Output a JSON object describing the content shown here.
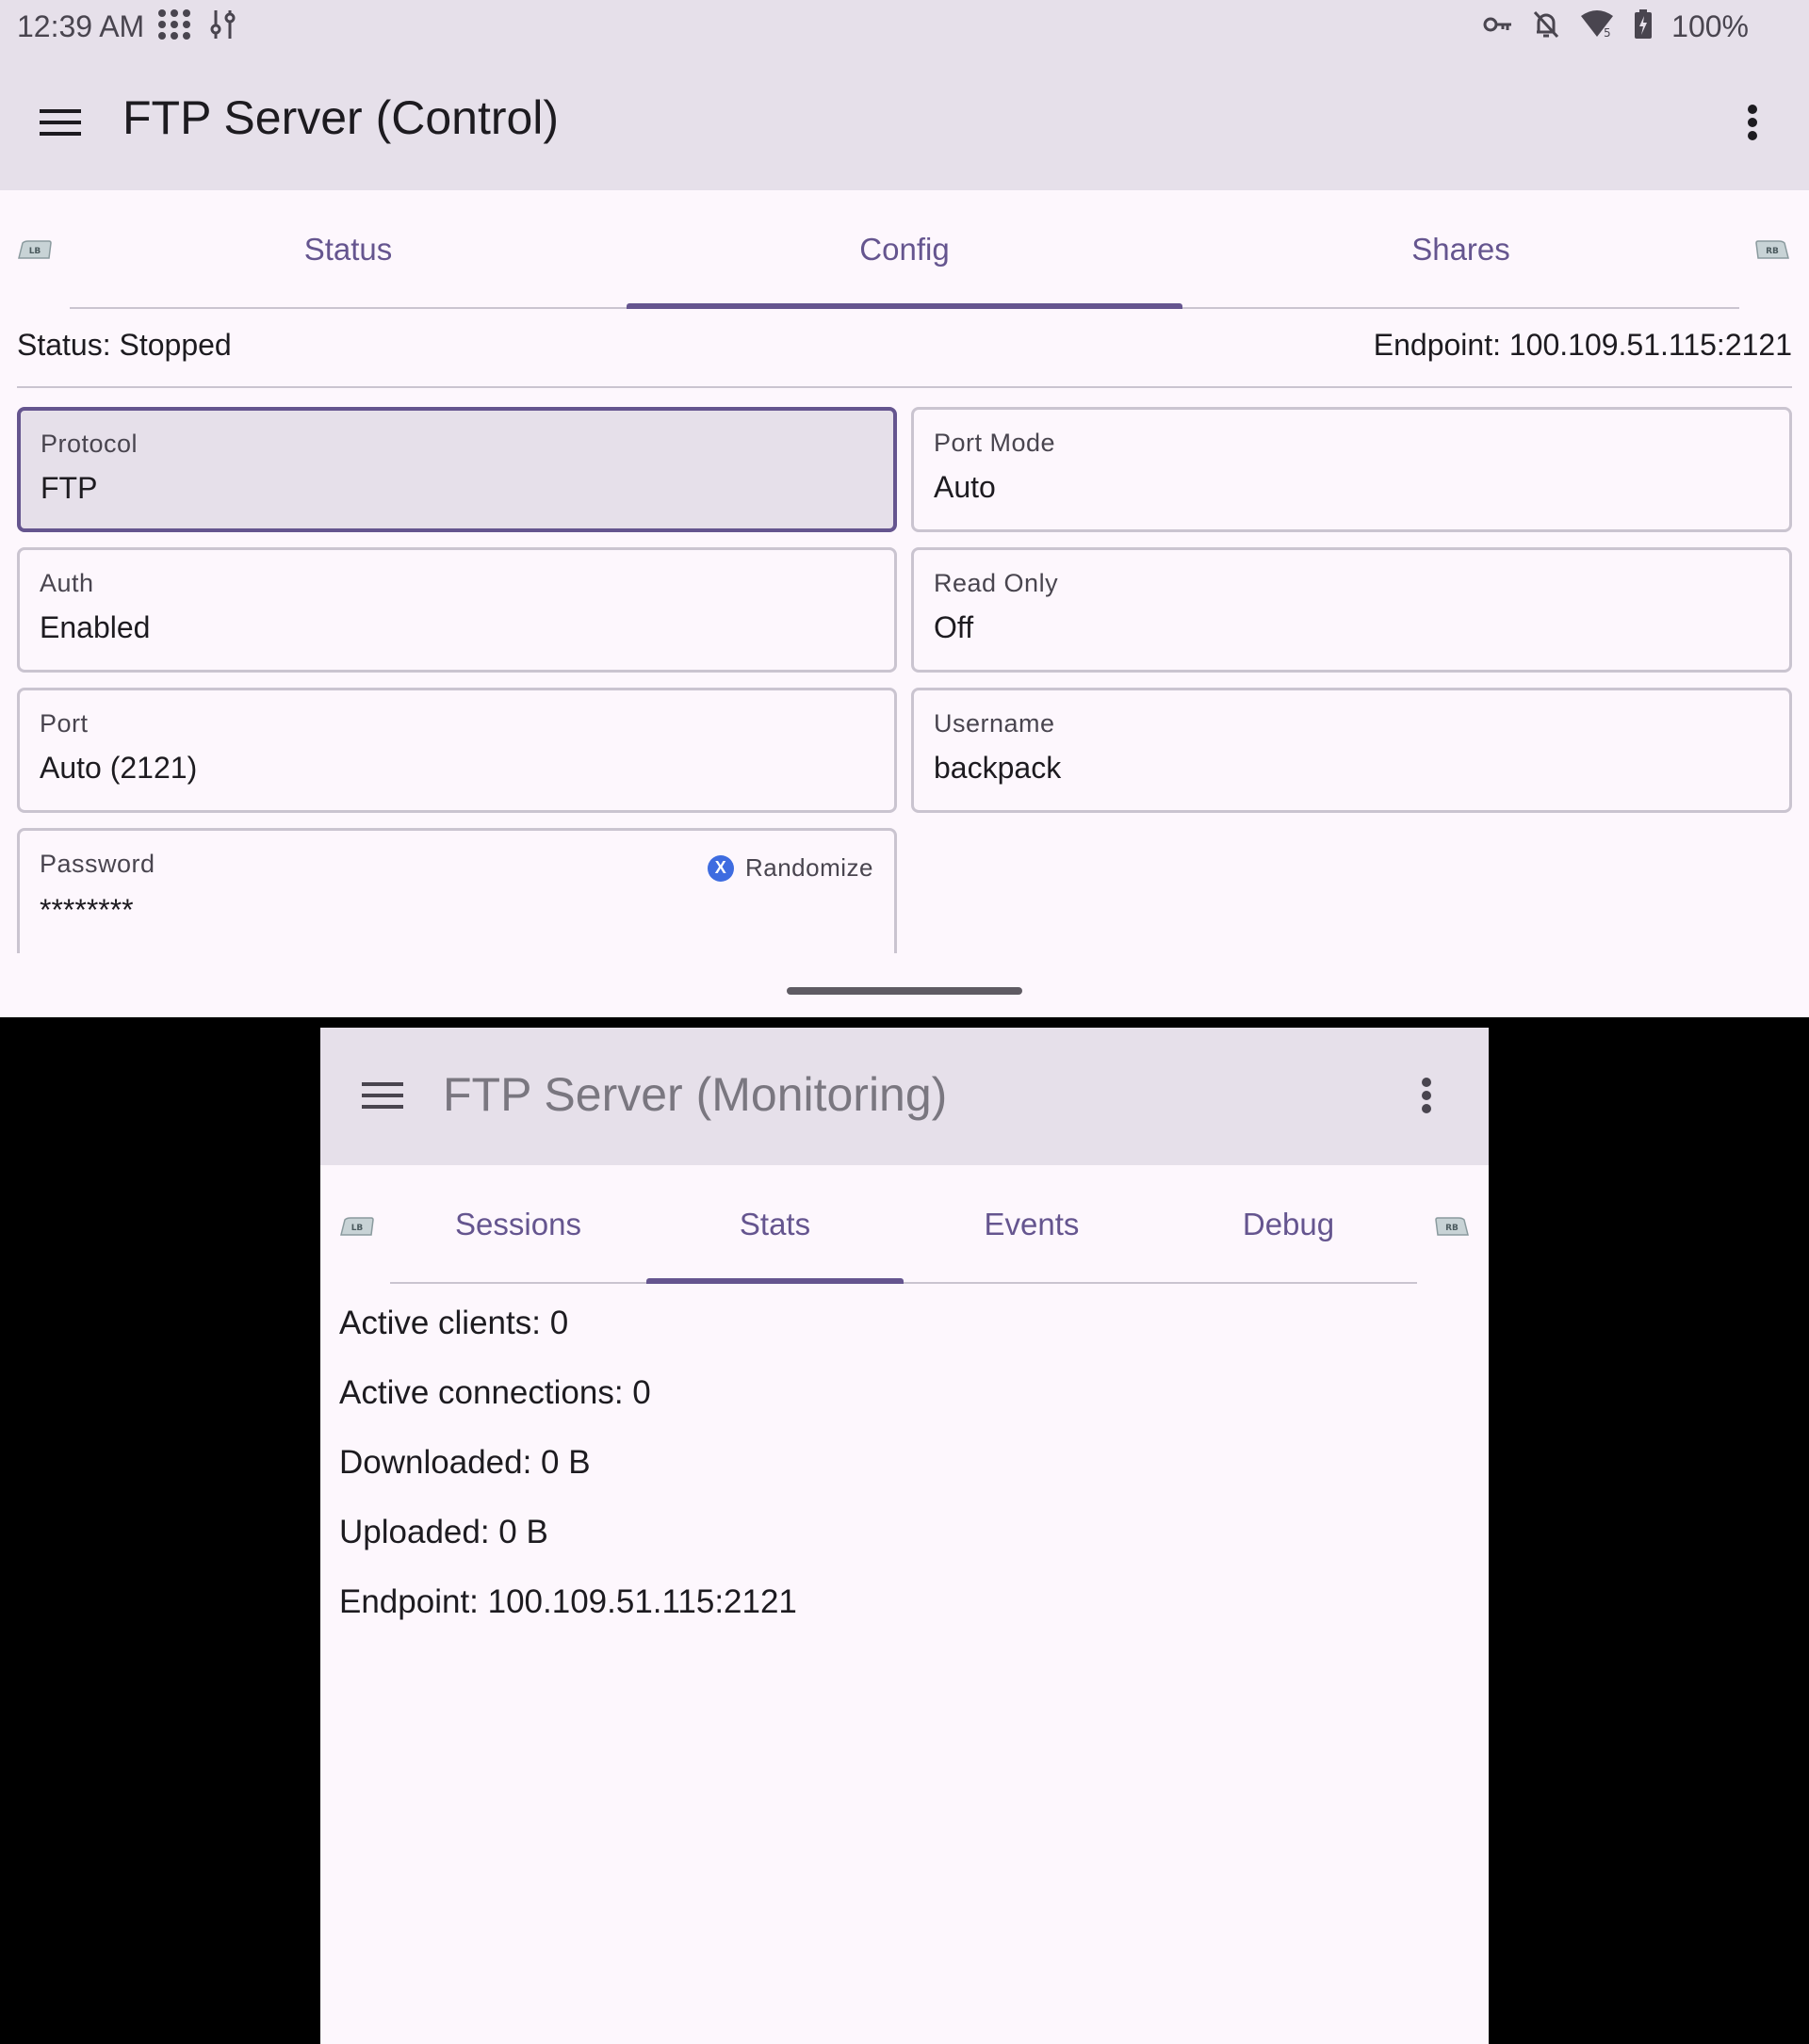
{
  "status_bar": {
    "time": "12:39 AM",
    "battery": "100%"
  },
  "control": {
    "title": "FTP Server (Control)",
    "tabs": [
      {
        "label": "Status"
      },
      {
        "label": "Config",
        "selected": true
      },
      {
        "label": "Shares"
      }
    ],
    "bumper_left": "LB",
    "bumper_right": "RB",
    "status_text": "Status: Stopped",
    "endpoint_text": "Endpoint: 100.109.51.115:2121",
    "fields": {
      "protocol": {
        "label": "Protocol",
        "value": "FTP"
      },
      "port_mode": {
        "label": "Port Mode",
        "value": "Auto"
      },
      "auth": {
        "label": "Auth",
        "value": "Enabled"
      },
      "read_only": {
        "label": "Read Only",
        "value": "Off"
      },
      "port": {
        "label": "Port",
        "value": "Auto (2121)"
      },
      "username": {
        "label": "Username",
        "value": "backpack"
      },
      "password": {
        "label": "Password",
        "value": "********",
        "action_label": "Randomize",
        "action_key": "X"
      }
    }
  },
  "monitoring": {
    "title": "FTP Server (Monitoring)",
    "tabs": [
      {
        "label": "Sessions"
      },
      {
        "label": "Stats",
        "selected": true
      },
      {
        "label": "Events"
      },
      {
        "label": "Debug"
      }
    ],
    "bumper_left": "LB",
    "bumper_right": "RB",
    "stats": [
      "Active clients: 0",
      "Active connections: 0",
      "Downloaded: 0 B",
      "Uploaded: 0 B",
      "Endpoint: 100.109.51.115:2121"
    ]
  },
  "colors": {
    "accent": "#65558f",
    "surface": "#fdf7fd",
    "bar": "#e6e0ea",
    "outline": "#cac4d0",
    "x_button": "#3e6ce0"
  }
}
